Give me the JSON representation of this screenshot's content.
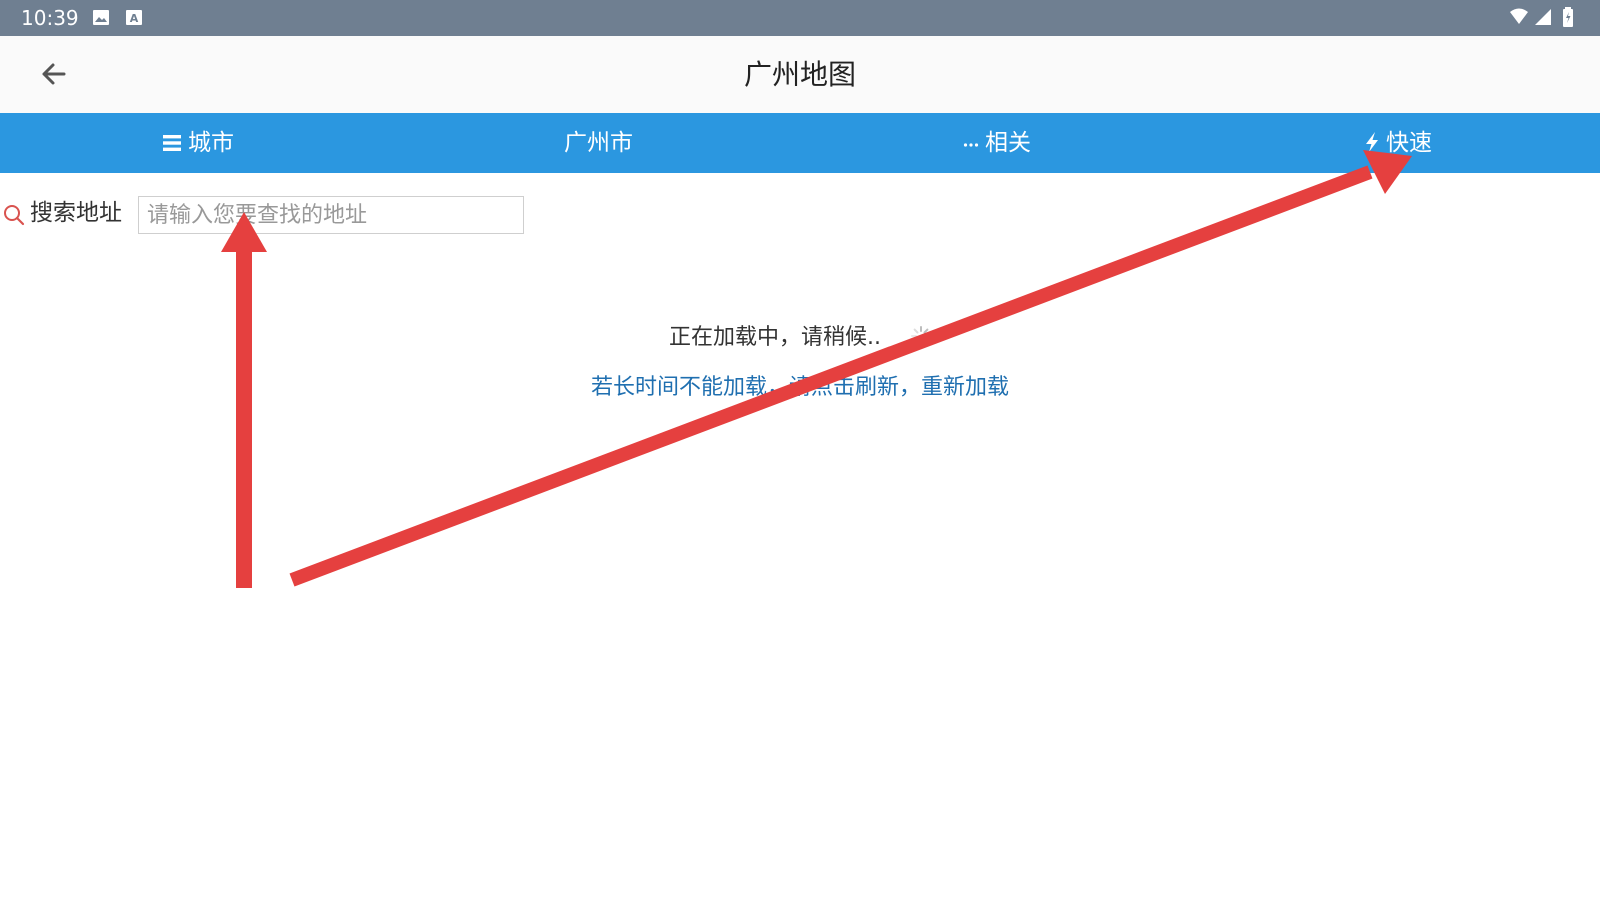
{
  "status_bar": {
    "time": "10:39",
    "left_icons": [
      "image-icon",
      "a-text-icon"
    ],
    "right_icons": [
      "wifi-icon",
      "signal-icon",
      "battery-charging-icon"
    ],
    "background_color": "#6f7f91"
  },
  "title_bar": {
    "back_icon": "arrow-left-icon",
    "title": "广州地图"
  },
  "nav_bar": {
    "background_color": "#2b97e0",
    "items": [
      {
        "label": "城市",
        "icon": "menu-icon"
      },
      {
        "label": "广州市",
        "icon": ""
      },
      {
        "label": "相关",
        "icon": "more-dots-icon"
      },
      {
        "label": "快速",
        "icon": "lightning-icon"
      }
    ]
  },
  "search": {
    "icon": "search-icon",
    "label": "搜索地址",
    "value": "",
    "placeholder": "请输入您要查找的地址"
  },
  "loading": {
    "text": "正在加载中，请稍候..",
    "spinner_icon": "loading-spinner-icon",
    "reload_text": "若长时间不能加载，请点击刷新，重新加载"
  },
  "annotations": {
    "arrow_color": "#e5403f",
    "arrows": [
      "pointing to search input",
      "pointing to 快速 tab"
    ]
  }
}
